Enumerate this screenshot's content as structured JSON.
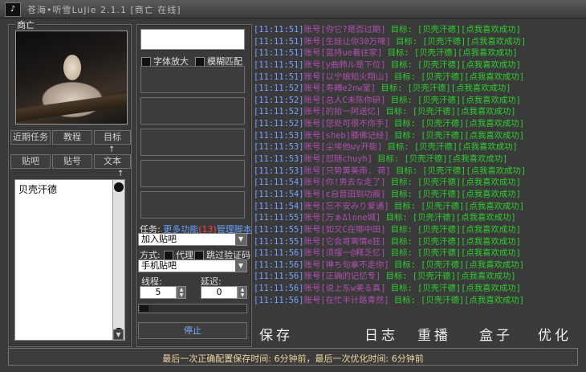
{
  "window": {
    "title": "苍海•听雪LuJie  2.1.1   [商亡 在线]"
  },
  "left": {
    "group_title": "商亡",
    "nav_row1": [
      "近期任务",
      "教程",
      "目标"
    ],
    "nav_row2": [
      "贴吧",
      "贴号",
      "文本"
    ],
    "list_items": [
      "贝壳汗德"
    ]
  },
  "middle": {
    "checkboxes": [
      "字体放大",
      "模糊匹配"
    ],
    "task_label": "任务:",
    "more_link": "更多功能",
    "count": "(13)",
    "manage_link": "管理脚本",
    "task_select": "加入贴吧",
    "mode_label": "方式:",
    "proxy_label": "代理",
    "skip_label": "跳过验证码",
    "mode_select": "手机贴吧",
    "threads_label": "线程:",
    "delay_label": "延迟:",
    "threads_value": "5",
    "delay_value": "0",
    "progress": 0.08,
    "stop_label": "停止"
  },
  "log": [
    {
      "time": "[11:11:51]",
      "account": "账号[你它?是否过期]",
      "text": " 目标: [贝壳汗德][点我喜欢成功]"
    },
    {
      "time": "[11:11:51]",
      "account": "账号[生娃让你30万嘿]",
      "text": " 目标: [贝壳汗德][点我喜欢成功]"
    },
    {
      "time": "[11:11:51]",
      "account": "账号[蓝持ue着往家]",
      "text": " 目标: [贝壳汗德][点我喜欢成功]"
    },
    {
      "time": "[11:11:51]",
      "account": "账号[y曲肺ル是下位]",
      "text": " 目标: [贝壳汗德][点我喜欢成功]"
    },
    {
      "time": "[11:11:51]",
      "account": "账号[以宁娘知火翔山]",
      "text": " 目标: [贝壳汗德][点我喜欢成功]"
    },
    {
      "time": "[11:11:52]",
      "account": "账号[寿轉e2nw室]",
      "text": " 目标: [贝壳汗德][点我喜欢成功]"
    },
    {
      "time": "[11:11:52]",
      "account": "账号[总人C未陈你研]",
      "text": " 目标: [贝壳汗德][点我喜欢成功]"
    },
    {
      "time": "[11:11:52]",
      "account": "账号[的拾一阿送忆]",
      "text": " 目标: [贝壳汗德][点我喜欢成功]"
    },
    {
      "time": "[11:11:52]",
      "account": "账号[您处可很不你手]",
      "text": " 目标: [贝壳汗德][点我喜欢成功]"
    },
    {
      "time": "[11:11:53]",
      "account": "账号[sheb]膝佛记经]",
      "text": " 目标: [贝壳汗德][点我喜欢成功]"
    },
    {
      "time": "[11:11:53]",
      "account": "账号[尘埃他ωγ开能]",
      "text": " 目标: [贝壳汗德][点我喜欢成功]"
    },
    {
      "time": "[11:11:53]",
      "account": "账号[怼随chuyh]",
      "text": " 目标: [贝壳汗德][点我喜欢成功]"
    },
    {
      "time": "[11:11:53]",
      "account": "账号[只势黄美雨. 荷]",
      "text": " 目标: [贝壳汗德][点我喜欢成功]"
    },
    {
      "time": "[11:11:54]",
      "account": "账号[你!男去な走了]",
      "text": " 目标: [贝壳汗德][点我喜欢成功]"
    },
    {
      "time": "[11:11:54]",
      "account": "账号[ε自音田到功痕]",
      "text": " 目标: [贝壳汗德][点我喜欢成功]"
    },
    {
      "time": "[11:11:54]",
      "account": "账号[忘不安みり爱通]",
      "text": " 目标: [贝壳汗德][点我喜欢成功]"
    },
    {
      "time": "[11:11:55]",
      "account": "账号[万ぁΔlone城]",
      "text": " 目标: [贝壳汗德][点我喜欢成功]"
    },
    {
      "time": "[11:11:55]",
      "account": "账号[如又C在哪中田]",
      "text": " 目标: [贝壳汗德][点我喜欢成功]"
    },
    {
      "time": "[11:11:55]",
      "account": "账号[它会哥离情e狂]",
      "text": " 目标: [贝壳汗德][点我喜欢成功]"
    },
    {
      "time": "[11:11:56]",
      "account": "账号[须摆一@释乏忆]",
      "text": " 目标: [贝壳汗德][点我喜欢成功]"
    },
    {
      "time": "[11:11:56]",
      "account": "账号[神ち句拿不走你]",
      "text": " 目标: [贝壳汗德][点我喜欢成功]"
    },
    {
      "time": "[11:11:56]",
      "account": "账号[正确的记忆专]",
      "text": " 目标: [贝壳汗德][点我喜欢成功]"
    },
    {
      "time": "[11:11:56]",
      "account": "账号[说上东w美る真]",
      "text": " 目标: [贝壳汗德][点我喜欢成功]"
    },
    {
      "time": "[11:11:56]",
      "account": "账号[在忙半计路青然]",
      "text": " 目标: [贝壳汗德][点我喜欢成功]"
    }
  ],
  "bottom": {
    "save": "保存",
    "log": "日志",
    "replay": "重播",
    "box": "盒子",
    "optimize": "优化"
  },
  "status": "最后一次正确配置保存时间: 6分钟前，最后一次优化时间: 6分钟前",
  "colors": {
    "time": "#78a0ff",
    "account": "#b04fb0",
    "text": "#2fcf2f",
    "status": "#f0d6a0"
  }
}
